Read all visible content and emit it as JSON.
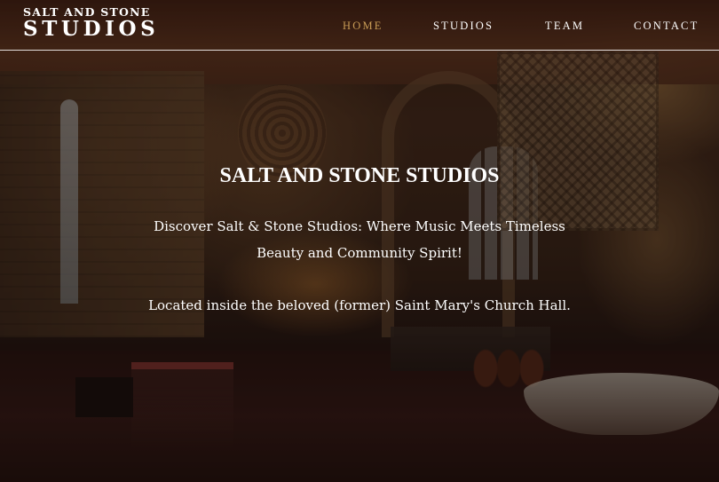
{
  "brand": {
    "name_top": "SALT AND STONE",
    "name_bottom": "STUDIOS"
  },
  "nav": {
    "items": [
      {
        "label": "HOME",
        "active": true
      },
      {
        "label": "STUDIOS",
        "active": false
      },
      {
        "label": "TEAM",
        "active": false
      },
      {
        "label": "CONTACT",
        "active": false
      }
    ]
  },
  "hero": {
    "title": "SALT AND STONE STUDIOS",
    "tagline": "Discover Salt & Stone Studios: Where Music Meets Timeless Beauty and Community Spirit!",
    "location": "Located inside the beloved (former) Saint Mary's Church Hall."
  },
  "colors": {
    "accent": "#c89b55",
    "text": "#ffffff"
  }
}
